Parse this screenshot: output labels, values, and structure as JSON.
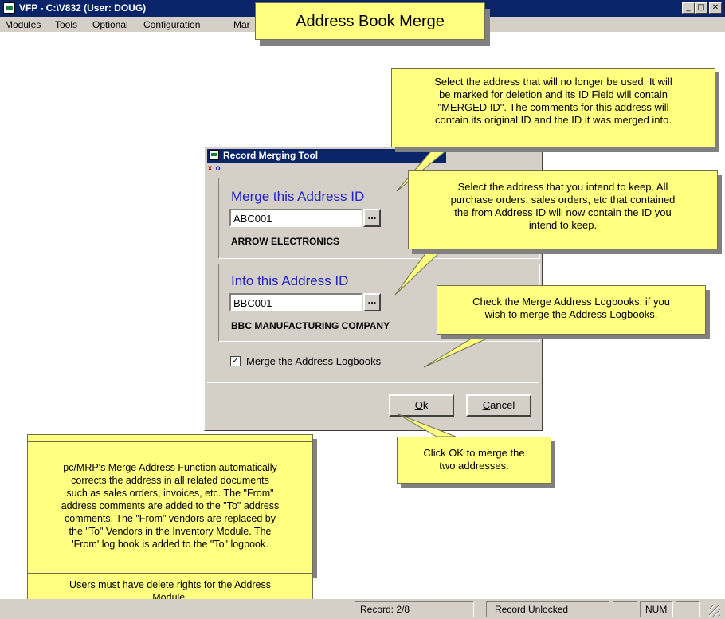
{
  "window": {
    "title": "VFP - C:\\V832  (User: DOUG)",
    "controls": {
      "minimize": "_",
      "maximize": "□",
      "close": "✕"
    }
  },
  "menu": [
    "Modules",
    "Tools",
    "Optional",
    "Configuration",
    "Mar"
  ],
  "banner": "Address Book Merge",
  "dialog": {
    "title": "Record Merging Tool",
    "mini_close": "x",
    "mini_other": "o",
    "from": {
      "label": "Merge this Address ID",
      "value": "ABC001",
      "lookup": "...",
      "name": "ARROW ELECTRONICS"
    },
    "to": {
      "label": "Into this Address ID",
      "value": "BBC001",
      "lookup": "...",
      "name": "BBC MANUFACTURING COMPANY"
    },
    "checkbox": {
      "label_pre": "Merge the Address ",
      "label_key": "L",
      "label_post": "ogbooks",
      "checked": true,
      "mark": "✓"
    },
    "ok": {
      "key": "O",
      "rest": "k"
    },
    "cancel": {
      "key": "C",
      "rest": "ancel"
    }
  },
  "callouts": {
    "no_longer_used": [
      "Select the address that will no longer be used. It will",
      "be marked for deletion and  its ID Field will contain",
      "\"MERGED ID\".  The comments for this address will",
      "contain its original ID and the ID it was merged into."
    ],
    "keep": [
      "Select the address that you intend to keep.  All",
      "purchase orders, sales orders, etc that contained",
      "the from Address ID will now contain the ID you",
      "intend to keep."
    ],
    "logbooks": [
      "Check the Merge Address Logbooks, if you",
      "wish to merge the Address Logbooks."
    ],
    "ok": [
      "Click OK to merge the",
      "two addresses."
    ],
    "function": [
      "pc/MRP's Merge Address Function automatically",
      "corrects the address in all related documents",
      "such as sales orders, invoices, etc.  The \"From\"",
      "address comments are added to the \"To\" address",
      "comments.  The \"From\" vendors are replaced by",
      "the \"To\" Vendors in the Inventory Module.  The",
      "'From' log book is added to the \"To\" logbook."
    ],
    "rights": [
      "Users must have delete rights for the Address",
      "Module."
    ]
  },
  "status": {
    "record": "Record: 2/8",
    "lock": "Record Unlocked",
    "num": "NUM"
  },
  "colors": {
    "callout": "#ffff80",
    "title_bar": "#0a246a",
    "heading": "#2323c8",
    "dialog_bg": "#d4d0c8"
  }
}
